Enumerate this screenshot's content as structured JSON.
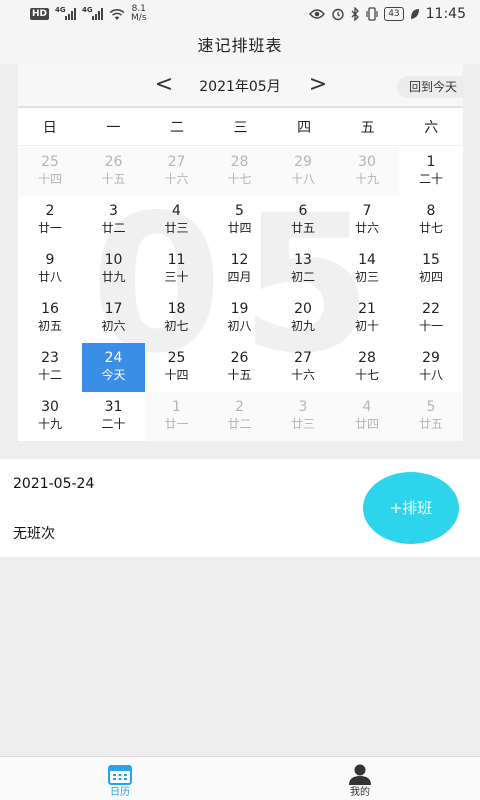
{
  "status_bar": {
    "hd": "HD",
    "sim1_label": "4G",
    "sim2_label": "4G",
    "speed_value": "8.1",
    "speed_unit": "M/s",
    "battery": "43",
    "time": "11:45",
    "icons": [
      "eye-icon",
      "alarm-icon",
      "bluetooth-icon",
      "vibrate-icon",
      "battery-icon",
      "leaf-icon"
    ]
  },
  "header": {
    "title": "速记排班表"
  },
  "calendar": {
    "month_label": "2021年05月",
    "prev": "<",
    "next": ">",
    "today_button": "回到今天",
    "watermark": "05",
    "weekdays": [
      "日",
      "一",
      "二",
      "三",
      "四",
      "五",
      "六"
    ],
    "days": [
      {
        "n": "25",
        "l": "十四",
        "other": true
      },
      {
        "n": "26",
        "l": "十五",
        "other": true
      },
      {
        "n": "27",
        "l": "十六",
        "other": true
      },
      {
        "n": "28",
        "l": "十七",
        "other": true
      },
      {
        "n": "29",
        "l": "十八",
        "other": true
      },
      {
        "n": "30",
        "l": "十九",
        "other": true
      },
      {
        "n": "1",
        "l": "二十"
      },
      {
        "n": "2",
        "l": "廿一"
      },
      {
        "n": "3",
        "l": "廿二"
      },
      {
        "n": "4",
        "l": "廿三"
      },
      {
        "n": "5",
        "l": "廿四"
      },
      {
        "n": "6",
        "l": "廿五"
      },
      {
        "n": "7",
        "l": "廿六"
      },
      {
        "n": "8",
        "l": "廿七"
      },
      {
        "n": "9",
        "l": "廿八"
      },
      {
        "n": "10",
        "l": "廿九"
      },
      {
        "n": "11",
        "l": "三十"
      },
      {
        "n": "12",
        "l": "四月"
      },
      {
        "n": "13",
        "l": "初二"
      },
      {
        "n": "14",
        "l": "初三"
      },
      {
        "n": "15",
        "l": "初四"
      },
      {
        "n": "16",
        "l": "初五"
      },
      {
        "n": "17",
        "l": "初六"
      },
      {
        "n": "18",
        "l": "初七"
      },
      {
        "n": "19",
        "l": "初八"
      },
      {
        "n": "20",
        "l": "初九"
      },
      {
        "n": "21",
        "l": "初十"
      },
      {
        "n": "22",
        "l": "十一"
      },
      {
        "n": "23",
        "l": "十二"
      },
      {
        "n": "24",
        "l": "今天",
        "selected": true
      },
      {
        "n": "25",
        "l": "十四"
      },
      {
        "n": "26",
        "l": "十五"
      },
      {
        "n": "27",
        "l": "十六"
      },
      {
        "n": "28",
        "l": "十七"
      },
      {
        "n": "29",
        "l": "十八"
      },
      {
        "n": "30",
        "l": "十九"
      },
      {
        "n": "31",
        "l": "二十"
      },
      {
        "n": "1",
        "l": "廿一",
        "other": true
      },
      {
        "n": "2",
        "l": "廿二",
        "other": true
      },
      {
        "n": "3",
        "l": "廿三",
        "other": true
      },
      {
        "n": "4",
        "l": "廿四",
        "other": true
      },
      {
        "n": "5",
        "l": "廿五",
        "other": true
      }
    ]
  },
  "info": {
    "date": "2021-05-24",
    "status": "无班次",
    "add_button": "+排班"
  },
  "tabs": [
    {
      "label": "日历",
      "icon": "calendar-icon",
      "active": true
    },
    {
      "label": "我的",
      "icon": "person-icon",
      "active": false
    }
  ],
  "colors": {
    "accent": "#3a8ee6",
    "add_button": "#2ed3ec",
    "tab_active": "#2aa3e8"
  }
}
